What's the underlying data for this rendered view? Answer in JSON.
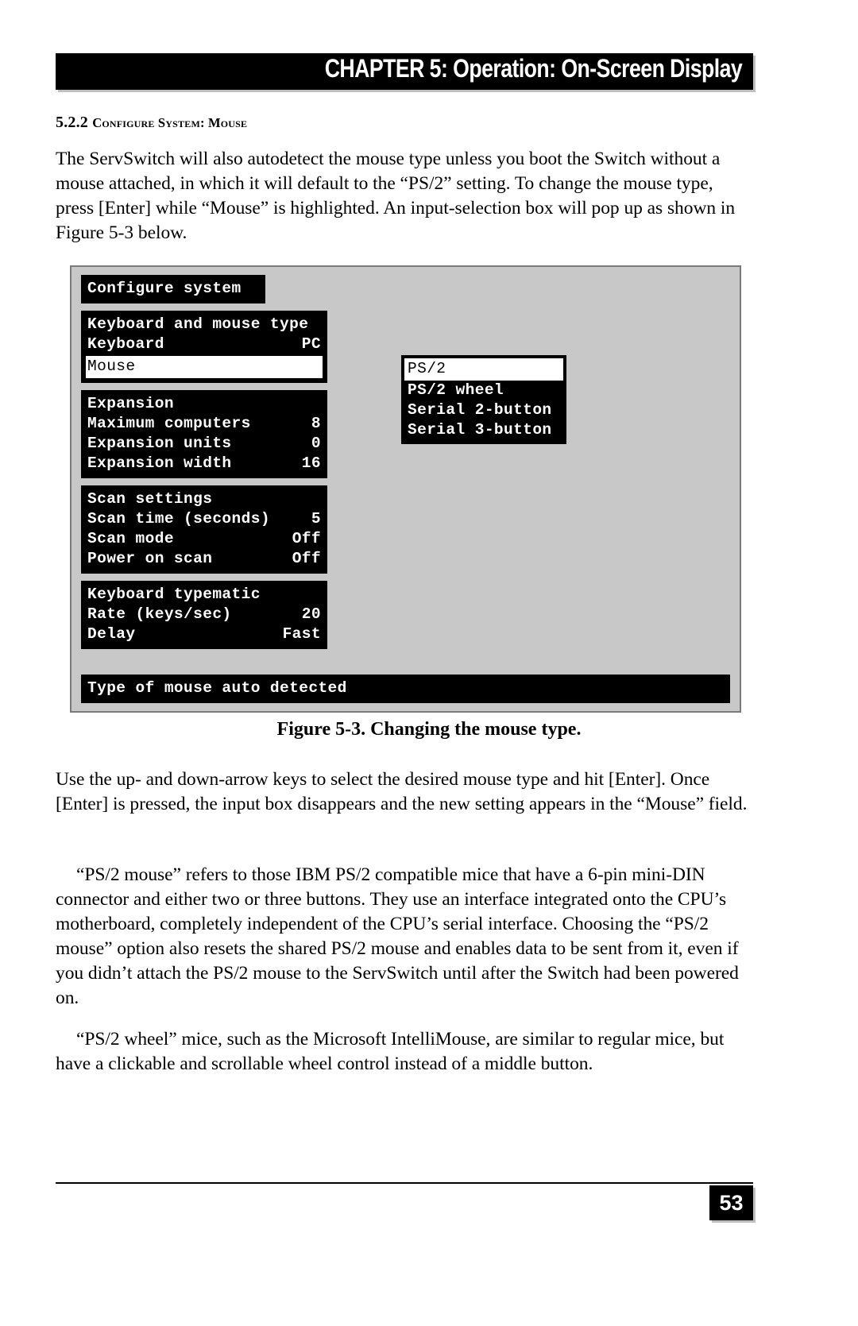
{
  "header": {
    "running_title": "CHAPTER 5: Operation: On-Screen Display"
  },
  "section": {
    "number": "5.2.2 ",
    "title": "Configure System: Mouse"
  },
  "body": {
    "intro": "The ServSwitch will also autodetect the mouse type unless you boot the Switch without a mouse attached, in which it will default to the “PS/2” setting. To change the mouse type, press [Enter] while “Mouse” is highlighted. An input-selection box will pop up as shown in Figure 5-3 below.",
    "use_arrows": "Use the up- and down-arrow keys to select the desired mouse type and hit [Enter]. Once [Enter] is pressed, the input box disappears and the new setting appears in the “Mouse” field.",
    "ps2_mouse": "“PS/2 mouse” refers to those IBM PS/2 compatible mice that have a 6-pin mini-DIN connector and either two or three buttons. They use an interface integrated onto the CPU’s motherboard, completely independent of the CPU’s serial interface. Choosing the “PS/2 mouse” option also resets the shared PS/2 mouse and enables data to be sent from it, even if you didn’t attach the PS/2 mouse to the ServSwitch until after the Switch had been powered on.",
    "ps2_wheel": "“PS/2 wheel” mice, such as the Microsoft IntelliMouse, are similar to regular mice, but have a clickable and scrollable wheel control instead of a middle button."
  },
  "figure": {
    "caption": "Figure 5-3. Changing the mouse type.",
    "osd": {
      "screen_title": "Configure system",
      "status_message": "Type of mouse auto detected",
      "sections": [
        {
          "heading": "Keyboard and mouse type",
          "rows": [
            {
              "label": "Keyboard",
              "value": "PC",
              "selected": false
            },
            {
              "label": "Mouse",
              "value": "",
              "selected": true
            }
          ]
        },
        {
          "heading": "Expansion",
          "rows": [
            {
              "label": "Maximum computers",
              "value": "8",
              "selected": false
            },
            {
              "label": "Expansion units",
              "value": "0",
              "selected": false
            },
            {
              "label": "Expansion width",
              "value": "16",
              "selected": false
            }
          ]
        },
        {
          "heading": "Scan settings",
          "rows": [
            {
              "label": "Scan time (seconds)",
              "value": "5",
              "selected": false
            },
            {
              "label": "Scan mode",
              "value": "Off",
              "selected": false
            },
            {
              "label": "Power on scan",
              "value": "Off",
              "selected": false
            }
          ]
        },
        {
          "heading": "Keyboard typematic",
          "rows": [
            {
              "label": "Rate (keys/sec)",
              "value": "20",
              "selected": false
            },
            {
              "label": "Delay",
              "value": "Fast",
              "selected": false
            }
          ]
        }
      ],
      "popup": {
        "options": [
          {
            "label": "PS/2",
            "selected": true
          },
          {
            "label": "PS/2 wheel",
            "selected": false
          },
          {
            "label": "Serial 2-button",
            "selected": false
          },
          {
            "label": "Serial 3-button",
            "selected": false
          }
        ]
      }
    }
  },
  "footer": {
    "page_number": "53"
  },
  "colors": {
    "osd_background": "#c8c8c8",
    "osd_panel": "#000000",
    "osd_text": "#ffffff",
    "highlight_background": "#ffffff",
    "highlight_text": "#000000",
    "page_background": "#ffffff"
  }
}
